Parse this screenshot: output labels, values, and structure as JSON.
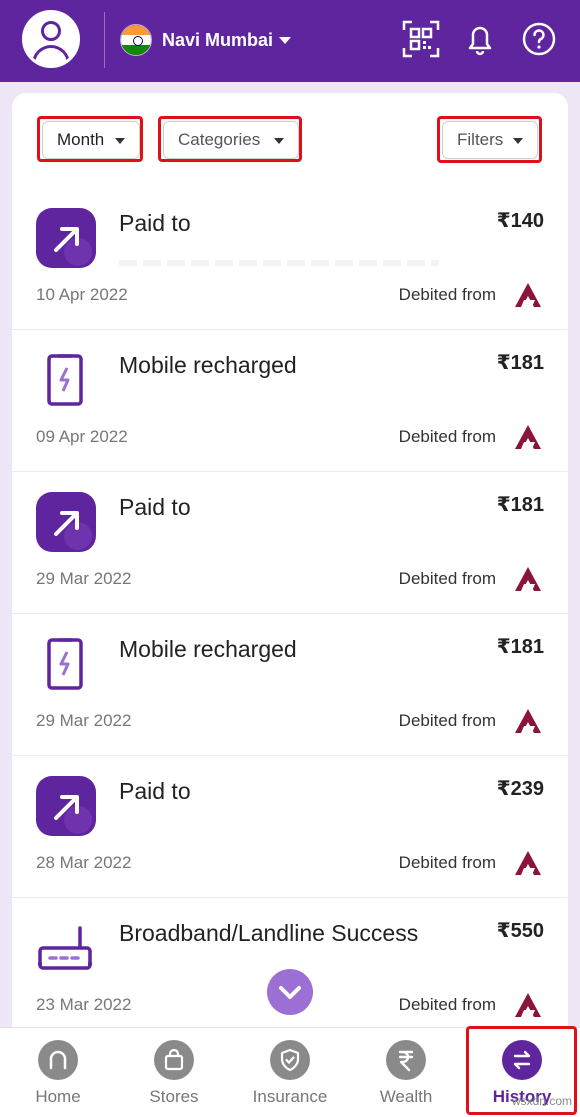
{
  "header": {
    "location": "Navi Mumbai",
    "icons": [
      "profile-avatar-icon",
      "india-flag-icon",
      "qr-scan-icon",
      "bell-icon",
      "help-icon"
    ],
    "brand_color": "#5f259f"
  },
  "filters": {
    "month": "Month",
    "categories": "Categories",
    "filters": "Filters"
  },
  "transactions": [
    {
      "title": "Paid to",
      "amount": "₹140",
      "date": "10 Apr 2022",
      "debit": "Debited from",
      "icon": "arrow-up-right-icon"
    },
    {
      "title": "Mobile recharged",
      "amount": "₹181",
      "date": "09 Apr 2022",
      "debit": "Debited from",
      "icon": "mobile-recharge-icon"
    },
    {
      "title": "Paid to",
      "amount": "₹181",
      "date": "29 Mar 2022",
      "debit": "Debited from",
      "icon": "arrow-up-right-icon"
    },
    {
      "title": "Mobile recharged",
      "amount": "₹181",
      "date": "29 Mar 2022",
      "debit": "Debited from",
      "icon": "mobile-recharge-icon"
    },
    {
      "title": "Paid to",
      "amount": "₹239",
      "date": "28 Mar 2022",
      "debit": "Debited from",
      "icon": "arrow-up-right-icon"
    },
    {
      "title": "Broadband/Landline Success",
      "amount": "₹550",
      "date": "23 Mar 2022",
      "debit": "Debited from",
      "icon": "router-icon"
    }
  ],
  "nav": {
    "items": [
      {
        "label": "Home",
        "icon": "home-icon"
      },
      {
        "label": "Stores",
        "icon": "shopping-bag-icon"
      },
      {
        "label": "Insurance",
        "icon": "shield-icon"
      },
      {
        "label": "Wealth",
        "icon": "rupee-icon"
      },
      {
        "label": "History",
        "icon": "swap-arrows-icon",
        "active": true
      }
    ]
  },
  "watermark": "wsxdn.com"
}
